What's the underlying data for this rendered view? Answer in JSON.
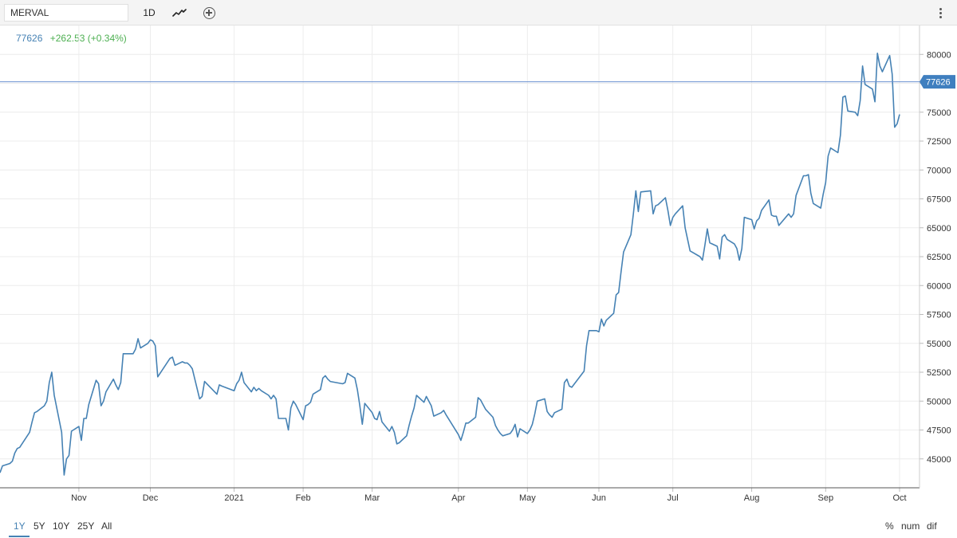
{
  "toolbar": {
    "symbol": "MERVAL",
    "interval": "1D",
    "chart_type_icon": "line-chart-icon",
    "compare_icon": "plus-circle-icon",
    "menu_icon": "vertical-dots-icon"
  },
  "legend": {
    "last_price": "77626",
    "change": "+262.53 (+0.34%)"
  },
  "colors": {
    "series": "#4682b4",
    "positive": "#4caf50",
    "price_tag": "#3f7fbf",
    "price_line": "#6a8fd0"
  },
  "range": {
    "options": [
      "1Y",
      "5Y",
      "10Y",
      "25Y",
      "All"
    ],
    "selected": "1Y"
  },
  "display_options": [
    "%",
    "num",
    "dif"
  ],
  "chart_data": {
    "type": "line",
    "x_tick_labels": [
      "Nov",
      "Dec",
      "2021",
      "Feb",
      "Mar",
      "Apr",
      "May",
      "Jun",
      "Jul",
      "Aug",
      "Sep",
      "Oct"
    ],
    "y_ticks": [
      45000,
      47500,
      50000,
      52500,
      55000,
      57500,
      60000,
      62500,
      65000,
      67500,
      70000,
      72500,
      75000,
      77500,
      80000
    ],
    "y_tick_labels": [
      "45000",
      "47500",
      "50000",
      "52500",
      "55000",
      "57500",
      "60000",
      "62500",
      "65000",
      "67500",
      "70000",
      "72500",
      "75000",
      "77500",
      "80000"
    ],
    "ylim": [
      42500,
      82500
    ],
    "last_value": 77626,
    "last_label": "77626",
    "grid": true,
    "series": [
      {
        "date": [
          "2020-10-01",
          "2020-10-02",
          "2020-10-05",
          "2020-10-06",
          "2020-10-07",
          "2020-10-08",
          "2020-10-09",
          "2020-10-13",
          "2020-10-14",
          "2020-10-15",
          "2020-10-16",
          "2020-10-19",
          "2020-10-20",
          "2020-10-21",
          "2020-10-22",
          "2020-10-23",
          "2020-10-26",
          "2020-10-27",
          "2020-10-28",
          "2020-10-29",
          "2020-10-30",
          "2020-11-02",
          "2020-11-03",
          "2020-11-04",
          "2020-11-05",
          "2020-11-06",
          "2020-11-09",
          "2020-11-10",
          "2020-11-11",
          "2020-11-12",
          "2020-11-13",
          "2020-11-16",
          "2020-11-17",
          "2020-11-18",
          "2020-11-19",
          "2020-11-20",
          "2020-11-24",
          "2020-11-25",
          "2020-11-26",
          "2020-11-27",
          "2020-11-30",
          "2020-12-01",
          "2020-12-02",
          "2020-12-03",
          "2020-12-04",
          "2020-12-09",
          "2020-12-10",
          "2020-12-11",
          "2020-12-14",
          "2020-12-15",
          "2020-12-16",
          "2020-12-17",
          "2020-12-18",
          "2020-12-21",
          "2020-12-22",
          "2020-12-23",
          "2020-12-28",
          "2020-12-29",
          "2020-12-30",
          "2021-01-04",
          "2021-01-05",
          "2021-01-06",
          "2021-01-07",
          "2021-01-08",
          "2021-01-11",
          "2021-01-12",
          "2021-01-13",
          "2021-01-14",
          "2021-01-15",
          "2021-01-18",
          "2021-01-19",
          "2021-01-20",
          "2021-01-21",
          "2021-01-22",
          "2021-01-25",
          "2021-01-26",
          "2021-01-27",
          "2021-01-28",
          "2021-01-29",
          "2021-02-01",
          "2021-02-02",
          "2021-02-03",
          "2021-02-04",
          "2021-02-05",
          "2021-02-08",
          "2021-02-09",
          "2021-02-10",
          "2021-02-11",
          "2021-02-12",
          "2021-02-17",
          "2021-02-18",
          "2021-02-19",
          "2021-02-22",
          "2021-02-23",
          "2021-02-24",
          "2021-02-25",
          "2021-02-26",
          "2021-03-01",
          "2021-03-02",
          "2021-03-03",
          "2021-03-04",
          "2021-03-05",
          "2021-03-08",
          "2021-03-09",
          "2021-03-10",
          "2021-03-11",
          "2021-03-12",
          "2021-03-15",
          "2021-03-16",
          "2021-03-17",
          "2021-03-18",
          "2021-03-19",
          "2021-03-22",
          "2021-03-23",
          "2021-03-25",
          "2021-03-26",
          "2021-03-29",
          "2021-03-30",
          "2021-03-31",
          "2021-04-05",
          "2021-04-06",
          "2021-04-07",
          "2021-04-08",
          "2021-04-09",
          "2021-04-12",
          "2021-04-13",
          "2021-04-14",
          "2021-04-15",
          "2021-04-16",
          "2021-04-19",
          "2021-04-20",
          "2021-04-21",
          "2021-04-22",
          "2021-04-23",
          "2021-04-26",
          "2021-04-27",
          "2021-04-28",
          "2021-04-29",
          "2021-04-30",
          "2021-05-03",
          "2021-05-04",
          "2021-05-05",
          "2021-05-06",
          "2021-05-07",
          "2021-05-10",
          "2021-05-11",
          "2021-05-12",
          "2021-05-13",
          "2021-05-14",
          "2021-05-17",
          "2021-05-18",
          "2021-05-19",
          "2021-05-20",
          "2021-05-21",
          "2021-05-26",
          "2021-05-27",
          "2021-05-28",
          "2021-05-31",
          "2021-06-01",
          "2021-06-02",
          "2021-06-03",
          "2021-06-04",
          "2021-06-07",
          "2021-06-08",
          "2021-06-09",
          "2021-06-10",
          "2021-06-11",
          "2021-06-14",
          "2021-06-15",
          "2021-06-16",
          "2021-06-17",
          "2021-06-18",
          "2021-06-22",
          "2021-06-23",
          "2021-06-24",
          "2021-06-25",
          "2021-06-28",
          "2021-06-29",
          "2021-06-30",
          "2021-07-01",
          "2021-07-02",
          "2021-07-05",
          "2021-07-06",
          "2021-07-07",
          "2021-07-08",
          "2021-07-12",
          "2021-07-13",
          "2021-07-14",
          "2021-07-15",
          "2021-07-16",
          "2021-07-19",
          "2021-07-20",
          "2021-07-21",
          "2021-07-22",
          "2021-07-23",
          "2021-07-26",
          "2021-07-27",
          "2021-07-28",
          "2021-07-29",
          "2021-07-30",
          "2021-08-02",
          "2021-08-03",
          "2021-08-04",
          "2021-08-05",
          "2021-08-06",
          "2021-08-09",
          "2021-08-10",
          "2021-08-11",
          "2021-08-12",
          "2021-08-13",
          "2021-08-17",
          "2021-08-18",
          "2021-08-19",
          "2021-08-20",
          "2021-08-23",
          "2021-08-24",
          "2021-08-25",
          "2021-08-26",
          "2021-08-27",
          "2021-08-30",
          "2021-08-31",
          "2021-09-01",
          "2021-09-02",
          "2021-09-03",
          "2021-09-06",
          "2021-09-07",
          "2021-09-08",
          "2021-09-09",
          "2021-09-10",
          "2021-09-13",
          "2021-09-14",
          "2021-09-15",
          "2021-09-16",
          "2021-09-17",
          "2021-09-20",
          "2021-09-21",
          "2021-09-22",
          "2021-09-23",
          "2021-09-24",
          "2021-09-27",
          "2021-09-28",
          "2021-09-29",
          "2021-09-30",
          "2021-10-01"
        ],
        "values": [
          43800,
          44400,
          44600,
          44800,
          45500,
          45900,
          46000,
          47300,
          48200,
          49000,
          49100,
          49600,
          50000,
          51600,
          52500,
          50500,
          47300,
          43600,
          45000,
          45300,
          47400,
          47800,
          46600,
          48500,
          48500,
          49700,
          51800,
          51500,
          49600,
          50000,
          50800,
          51900,
          51400,
          51000,
          51600,
          54100,
          54100,
          54500,
          55400,
          54600,
          55000,
          55300,
          55200,
          54800,
          52100,
          53700,
          53800,
          53100,
          53400,
          53300,
          53300,
          53100,
          52800,
          50200,
          50400,
          51700,
          50600,
          51400,
          51300,
          50900,
          51500,
          51800,
          52500,
          51600,
          50800,
          51200,
          50900,
          51100,
          50900,
          50500,
          50200,
          50500,
          50200,
          48500,
          48500,
          47500,
          49400,
          50000,
          49700,
          48400,
          49600,
          49700,
          49900,
          50600,
          51000,
          52000,
          52200,
          51900,
          51700,
          51500,
          51600,
          52400,
          52000,
          51000,
          49600,
          48000,
          49800,
          49000,
          48500,
          48400,
          49100,
          48200,
          47400,
          47800,
          47300,
          46300,
          46400,
          47000,
          47900,
          48700,
          49400,
          50500,
          49900,
          50400,
          49600,
          48700,
          49000,
          49200,
          48800,
          47100,
          46600,
          47300,
          48100,
          48100,
          48600,
          50300,
          50100,
          49700,
          49300,
          48600,
          47900,
          47500,
          47200,
          47000,
          47200,
          47500,
          48000,
          46900,
          47600,
          47200,
          47500,
          48000,
          48900,
          50000,
          50200,
          49100,
          48800,
          48600,
          49000,
          49300,
          51600,
          51900,
          51300,
          51200,
          52600,
          54800,
          56100,
          56100,
          56000,
          57100,
          56500,
          57000,
          57600,
          59200,
          59400,
          61200,
          62900,
          64400,
          66200,
          68200,
          66400,
          68100,
          68200,
          66200,
          66900,
          67000,
          67600,
          66500,
          65200,
          65900,
          66200,
          66900,
          65000,
          64000,
          63000,
          62500,
          62200,
          63500,
          64900,
          63700,
          63400,
          62300,
          64200,
          64400,
          64000,
          63600,
          63200,
          62200,
          63200,
          65900,
          65700,
          64900,
          65600,
          65800,
          66500,
          67400,
          66100,
          66000,
          66000,
          65200,
          66200,
          65900,
          66200,
          67800,
          69500,
          69500,
          69600,
          68000,
          67100,
          66700,
          67900,
          68900,
          71200,
          71900,
          71500,
          73000,
          76300,
          76400,
          75100,
          75000,
          74700,
          76000,
          79000,
          77400,
          77000,
          75900,
          80100,
          79000,
          78500,
          79900,
          78300,
          73700,
          74000,
          74800,
          74800,
          74200,
          75700,
          75800,
          76500,
          77300,
          77626
        ]
      }
    ]
  }
}
